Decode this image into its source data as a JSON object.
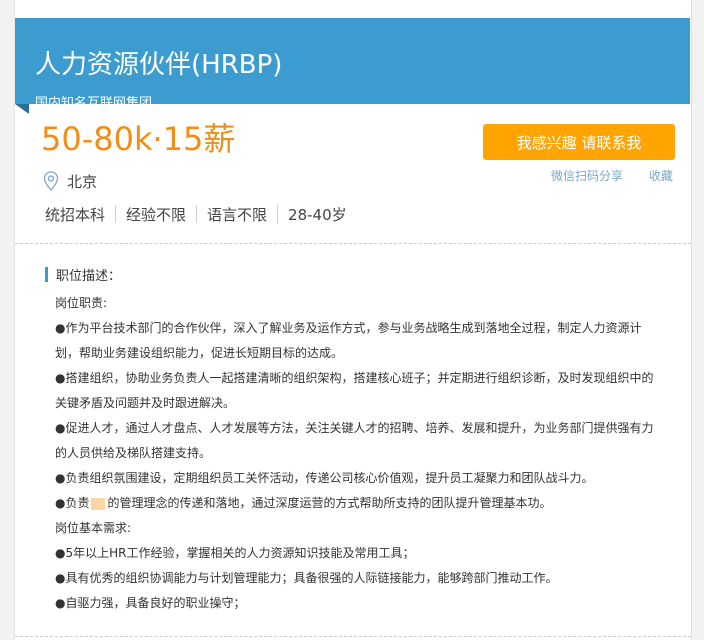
{
  "job": {
    "title": "人力资源伙伴(HRBP)",
    "company": "国内知名互联网集团",
    "salary": "50-80k·15薪",
    "location": "北京",
    "requirements": [
      "统招本科",
      "经验不限",
      "语言不限",
      "28-40岁"
    ]
  },
  "actions": {
    "interest_label": "我感兴趣 请联系我",
    "share_label": "微信扫码分享",
    "favorite_label": "收藏"
  },
  "description": {
    "heading": "职位描述：",
    "lines": [
      "岗位职责:",
      "●作为平台技术部门的合作伙伴，深入了解业务及运作方式，参与业务战略生成到落地全过程，制定人力资源计",
      "划，帮助业务建设组织能力，促进长短期目标的达成。",
      "●搭建组织，协助业务负责人一起搭建清晰的组织架构，搭建核心班子；并定期进行组织诊断，及时发现组织中的",
      "关键矛盾及问题并及时跟进解决。",
      "●促进人才，通过人才盘点、人才发展等方法，关注关键人才的招聘、培养、发展和提升，为业务部门提供强有力",
      "的人员供给及梯队搭建支持。",
      "●负责组织氛围建设，定期组织员工关怀活动，传递公司核心价值观，提升员工凝聚力和团队战斗力。"
    ],
    "masked_line_prefix": "●负责",
    "masked_line_suffix": "的管理理念的传递和落地，通过深度运营的方式帮助所支持的团队提升管理基本功。",
    "lines_after": [
      "岗位基本需求:",
      "●5年以上HR工作经验，掌握相关的人力资源知识技能及常用工具；",
      "●具有优秀的组织协调能力与计划管理能力；具备很强的人际链接能力，能够跨部门推动工作。",
      "●自驱力强，具备良好的职业操守；"
    ]
  },
  "colors": {
    "banner": "#3d9ccf",
    "salary": "#f38d17",
    "button": "#ffa400",
    "link": "#7aa7c8"
  }
}
